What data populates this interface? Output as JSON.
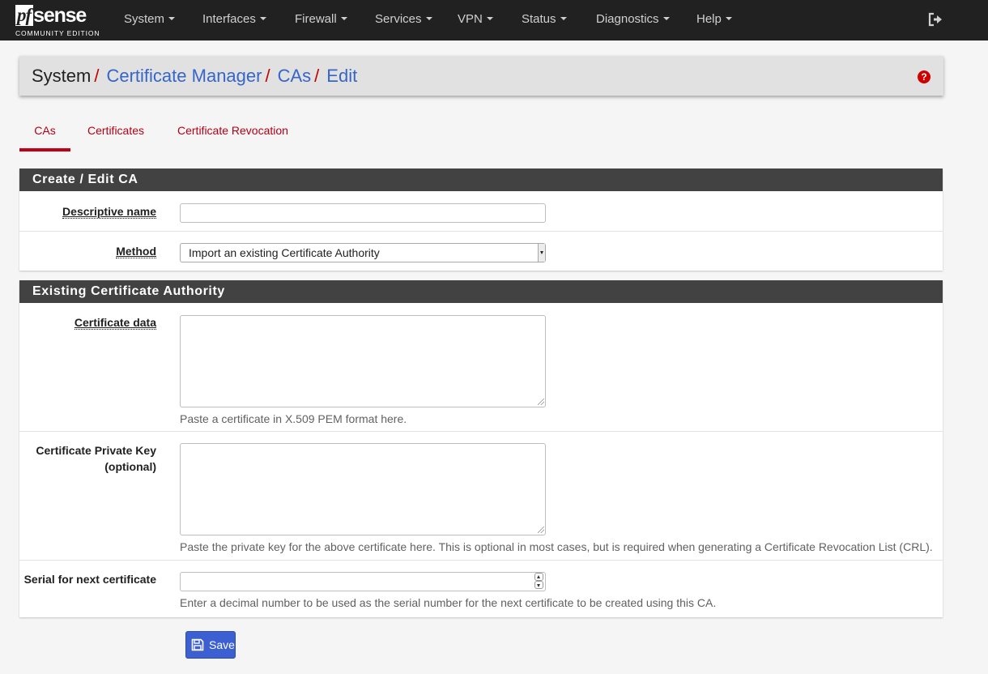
{
  "navbar": {
    "logo_pf": "pf",
    "logo_sense": "sense",
    "logo_sub": "COMMUNITY EDITION",
    "items": [
      {
        "label": "System"
      },
      {
        "label": "Interfaces"
      },
      {
        "label": "Firewall"
      },
      {
        "label": "Services"
      },
      {
        "label": "VPN"
      },
      {
        "label": "Status"
      },
      {
        "label": "Diagnostics"
      },
      {
        "label": "Help"
      }
    ],
    "logout_icon": "sign-out-icon"
  },
  "breadcrumb": {
    "items": [
      "System",
      "Certificate Manager",
      "CAs",
      "Edit"
    ],
    "separator": "/",
    "help_icon": "question-circle-icon"
  },
  "tabs": [
    {
      "label": "CAs",
      "active": true
    },
    {
      "label": "Certificates",
      "active": false
    },
    {
      "label": "Certificate Revocation",
      "active": false
    }
  ],
  "panel_create": {
    "title": "Create / Edit CA",
    "descriptive_name": {
      "label": "Descriptive name",
      "value": ""
    },
    "method": {
      "label": "Method",
      "value": "Import an existing Certificate Authority"
    }
  },
  "panel_existing": {
    "title": "Existing Certificate Authority",
    "cert_data": {
      "label": "Certificate data",
      "value": "",
      "help": "Paste a certificate in X.509 PEM format here."
    },
    "private_key": {
      "label_line1": "Certificate Private Key",
      "label_line2": "(optional)",
      "value": "",
      "help": "Paste the private key for the above certificate here. This is optional in most cases, but is required when generating a Certificate Revocation List (CRL)."
    },
    "serial": {
      "label": "Serial for next certificate",
      "value": "",
      "help": "Enter a decimal number to be used as the serial number for the next certificate to be created using this CA."
    }
  },
  "save": {
    "label": "Save",
    "icon": "save-icon"
  },
  "colors": {
    "navbar": "#212121",
    "panel_head": "#424242",
    "link": "#3566c8",
    "tab": "#b00018",
    "primary_button": "#3c5fd1",
    "help_icon": "#d00000"
  }
}
